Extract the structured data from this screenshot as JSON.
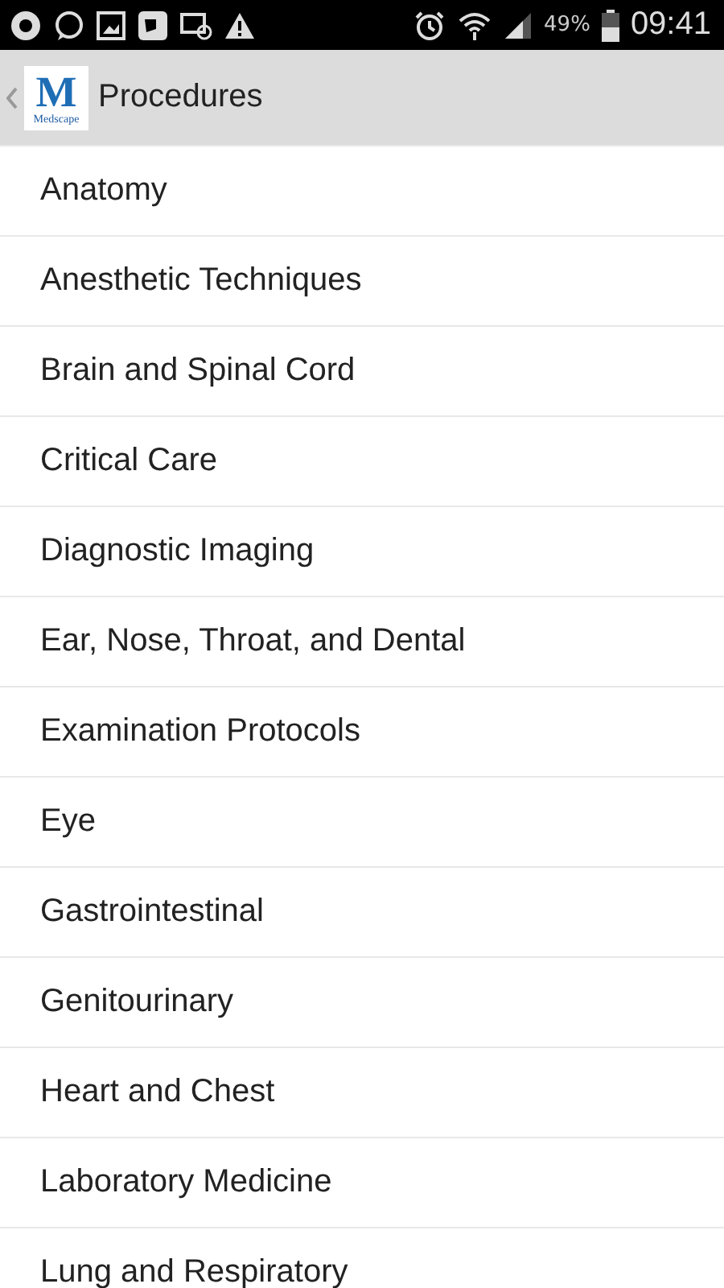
{
  "status_bar": {
    "battery": "49%",
    "time": "09:41"
  },
  "header": {
    "logo_letter": "M",
    "logo_word": "Medscape",
    "title": "Procedures"
  },
  "items": [
    {
      "label": "Anatomy"
    },
    {
      "label": "Anesthetic Techniques"
    },
    {
      "label": "Brain and Spinal Cord"
    },
    {
      "label": "Critical Care"
    },
    {
      "label": "Diagnostic Imaging"
    },
    {
      "label": "Ear, Nose, Throat, and Dental"
    },
    {
      "label": "Examination Protocols"
    },
    {
      "label": "Eye"
    },
    {
      "label": "Gastrointestinal"
    },
    {
      "label": "Genitourinary"
    },
    {
      "label": "Heart and Chest"
    },
    {
      "label": "Laboratory Medicine"
    },
    {
      "label": "Lung and Respiratory"
    }
  ]
}
